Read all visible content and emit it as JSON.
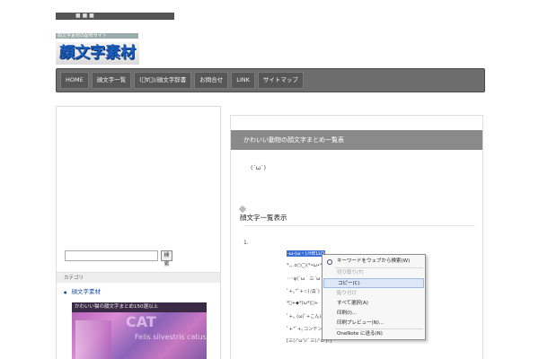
{
  "site": {
    "topbar_text": "■ ■ ■",
    "tagline": "顔文字素材の配布サイト",
    "logo": "顔文字素材"
  },
  "nav": [
    {
      "label": "HOME"
    },
    {
      "label": "顔文字一覧"
    },
    {
      "label": "(ﾟ∀ﾟ)/顔文字辞書"
    },
    {
      "label": "お問合せ"
    },
    {
      "label": "LINK"
    },
    {
      "label": "サイトマップ"
    }
  ],
  "sidebar": {
    "search_button": "検索",
    "section_heading": "カテゴリ",
    "link": "顔文字素材",
    "thumb_caption": "かわいい猫の顔文字まとめ150選以上",
    "thumb_big": "CAT",
    "thumb_sub": "Felis silvestris catus"
  },
  "main": {
    "post_title": "かわいい動物の顔文字まとめ一覧表",
    "face": "(´ω`)",
    "section_heading": "顔文字一覧表示",
    "list_number": "1.",
    "lines": [
      "-ω-(ω・)ﾉHELLO",
      "*.｡.o○◯(*•ω•*)",
      "･･･φ(´ω｀三´ω｀)",
      "ﾟ+｡*ﾟ+☆(ﾉД`)",
      "*ﾟ+◆*(ω*)ﾟ+",
      "ﾟ+｡ (ω)ﾟ+こんにちは",
      "ﾟ+*ﾟ+｡コンテンツ",
      "[三(ﾉ'ω')ﾉﾞ三(ﾉ'ω')ﾉ]"
    ]
  },
  "context_menu": {
    "items": [
      {
        "label": "キーワードをウェブから検索(W)",
        "state": "normal",
        "icon": "search-icon"
      },
      {
        "label": "切り取り(T)",
        "state": "disabled"
      },
      {
        "label": "コピー(C)",
        "state": "hover"
      },
      {
        "label": "貼り付け",
        "state": "disabled"
      },
      {
        "label": "すべて選択(A)",
        "state": "normal"
      },
      {
        "label": "印刷(I)...",
        "state": "normal"
      },
      {
        "label": "印刷プレビュー(N)...",
        "state": "normal"
      },
      {
        "label": "OneNote に送る(N)",
        "state": "normal"
      }
    ]
  }
}
